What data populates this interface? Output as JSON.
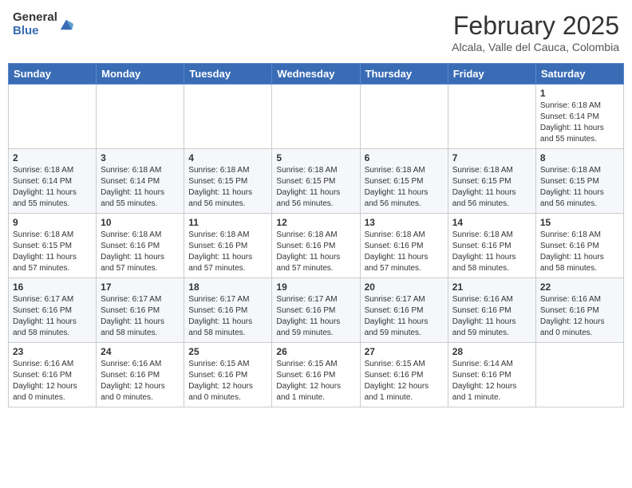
{
  "header": {
    "logo_general": "General",
    "logo_blue": "Blue",
    "month_title": "February 2025",
    "location": "Alcala, Valle del Cauca, Colombia"
  },
  "weekdays": [
    "Sunday",
    "Monday",
    "Tuesday",
    "Wednesday",
    "Thursday",
    "Friday",
    "Saturday"
  ],
  "weeks": [
    [
      {
        "day": "",
        "info": ""
      },
      {
        "day": "",
        "info": ""
      },
      {
        "day": "",
        "info": ""
      },
      {
        "day": "",
        "info": ""
      },
      {
        "day": "",
        "info": ""
      },
      {
        "day": "",
        "info": ""
      },
      {
        "day": "1",
        "info": "Sunrise: 6:18 AM\nSunset: 6:14 PM\nDaylight: 11 hours\nand 55 minutes."
      }
    ],
    [
      {
        "day": "2",
        "info": "Sunrise: 6:18 AM\nSunset: 6:14 PM\nDaylight: 11 hours\nand 55 minutes."
      },
      {
        "day": "3",
        "info": "Sunrise: 6:18 AM\nSunset: 6:14 PM\nDaylight: 11 hours\nand 55 minutes."
      },
      {
        "day": "4",
        "info": "Sunrise: 6:18 AM\nSunset: 6:15 PM\nDaylight: 11 hours\nand 56 minutes."
      },
      {
        "day": "5",
        "info": "Sunrise: 6:18 AM\nSunset: 6:15 PM\nDaylight: 11 hours\nand 56 minutes."
      },
      {
        "day": "6",
        "info": "Sunrise: 6:18 AM\nSunset: 6:15 PM\nDaylight: 11 hours\nand 56 minutes."
      },
      {
        "day": "7",
        "info": "Sunrise: 6:18 AM\nSunset: 6:15 PM\nDaylight: 11 hours\nand 56 minutes."
      },
      {
        "day": "8",
        "info": "Sunrise: 6:18 AM\nSunset: 6:15 PM\nDaylight: 11 hours\nand 56 minutes."
      }
    ],
    [
      {
        "day": "9",
        "info": "Sunrise: 6:18 AM\nSunset: 6:15 PM\nDaylight: 11 hours\nand 57 minutes."
      },
      {
        "day": "10",
        "info": "Sunrise: 6:18 AM\nSunset: 6:16 PM\nDaylight: 11 hours\nand 57 minutes."
      },
      {
        "day": "11",
        "info": "Sunrise: 6:18 AM\nSunset: 6:16 PM\nDaylight: 11 hours\nand 57 minutes."
      },
      {
        "day": "12",
        "info": "Sunrise: 6:18 AM\nSunset: 6:16 PM\nDaylight: 11 hours\nand 57 minutes."
      },
      {
        "day": "13",
        "info": "Sunrise: 6:18 AM\nSunset: 6:16 PM\nDaylight: 11 hours\nand 57 minutes."
      },
      {
        "day": "14",
        "info": "Sunrise: 6:18 AM\nSunset: 6:16 PM\nDaylight: 11 hours\nand 58 minutes."
      },
      {
        "day": "15",
        "info": "Sunrise: 6:18 AM\nSunset: 6:16 PM\nDaylight: 11 hours\nand 58 minutes."
      }
    ],
    [
      {
        "day": "16",
        "info": "Sunrise: 6:17 AM\nSunset: 6:16 PM\nDaylight: 11 hours\nand 58 minutes."
      },
      {
        "day": "17",
        "info": "Sunrise: 6:17 AM\nSunset: 6:16 PM\nDaylight: 11 hours\nand 58 minutes."
      },
      {
        "day": "18",
        "info": "Sunrise: 6:17 AM\nSunset: 6:16 PM\nDaylight: 11 hours\nand 58 minutes."
      },
      {
        "day": "19",
        "info": "Sunrise: 6:17 AM\nSunset: 6:16 PM\nDaylight: 11 hours\nand 59 minutes."
      },
      {
        "day": "20",
        "info": "Sunrise: 6:17 AM\nSunset: 6:16 PM\nDaylight: 11 hours\nand 59 minutes."
      },
      {
        "day": "21",
        "info": "Sunrise: 6:16 AM\nSunset: 6:16 PM\nDaylight: 11 hours\nand 59 minutes."
      },
      {
        "day": "22",
        "info": "Sunrise: 6:16 AM\nSunset: 6:16 PM\nDaylight: 12 hours\nand 0 minutes."
      }
    ],
    [
      {
        "day": "23",
        "info": "Sunrise: 6:16 AM\nSunset: 6:16 PM\nDaylight: 12 hours\nand 0 minutes."
      },
      {
        "day": "24",
        "info": "Sunrise: 6:16 AM\nSunset: 6:16 PM\nDaylight: 12 hours\nand 0 minutes."
      },
      {
        "day": "25",
        "info": "Sunrise: 6:15 AM\nSunset: 6:16 PM\nDaylight: 12 hours\nand 0 minutes."
      },
      {
        "day": "26",
        "info": "Sunrise: 6:15 AM\nSunset: 6:16 PM\nDaylight: 12 hours\nand 1 minute."
      },
      {
        "day": "27",
        "info": "Sunrise: 6:15 AM\nSunset: 6:16 PM\nDaylight: 12 hours\nand 1 minute."
      },
      {
        "day": "28",
        "info": "Sunrise: 6:14 AM\nSunset: 6:16 PM\nDaylight: 12 hours\nand 1 minute."
      },
      {
        "day": "",
        "info": ""
      }
    ]
  ]
}
